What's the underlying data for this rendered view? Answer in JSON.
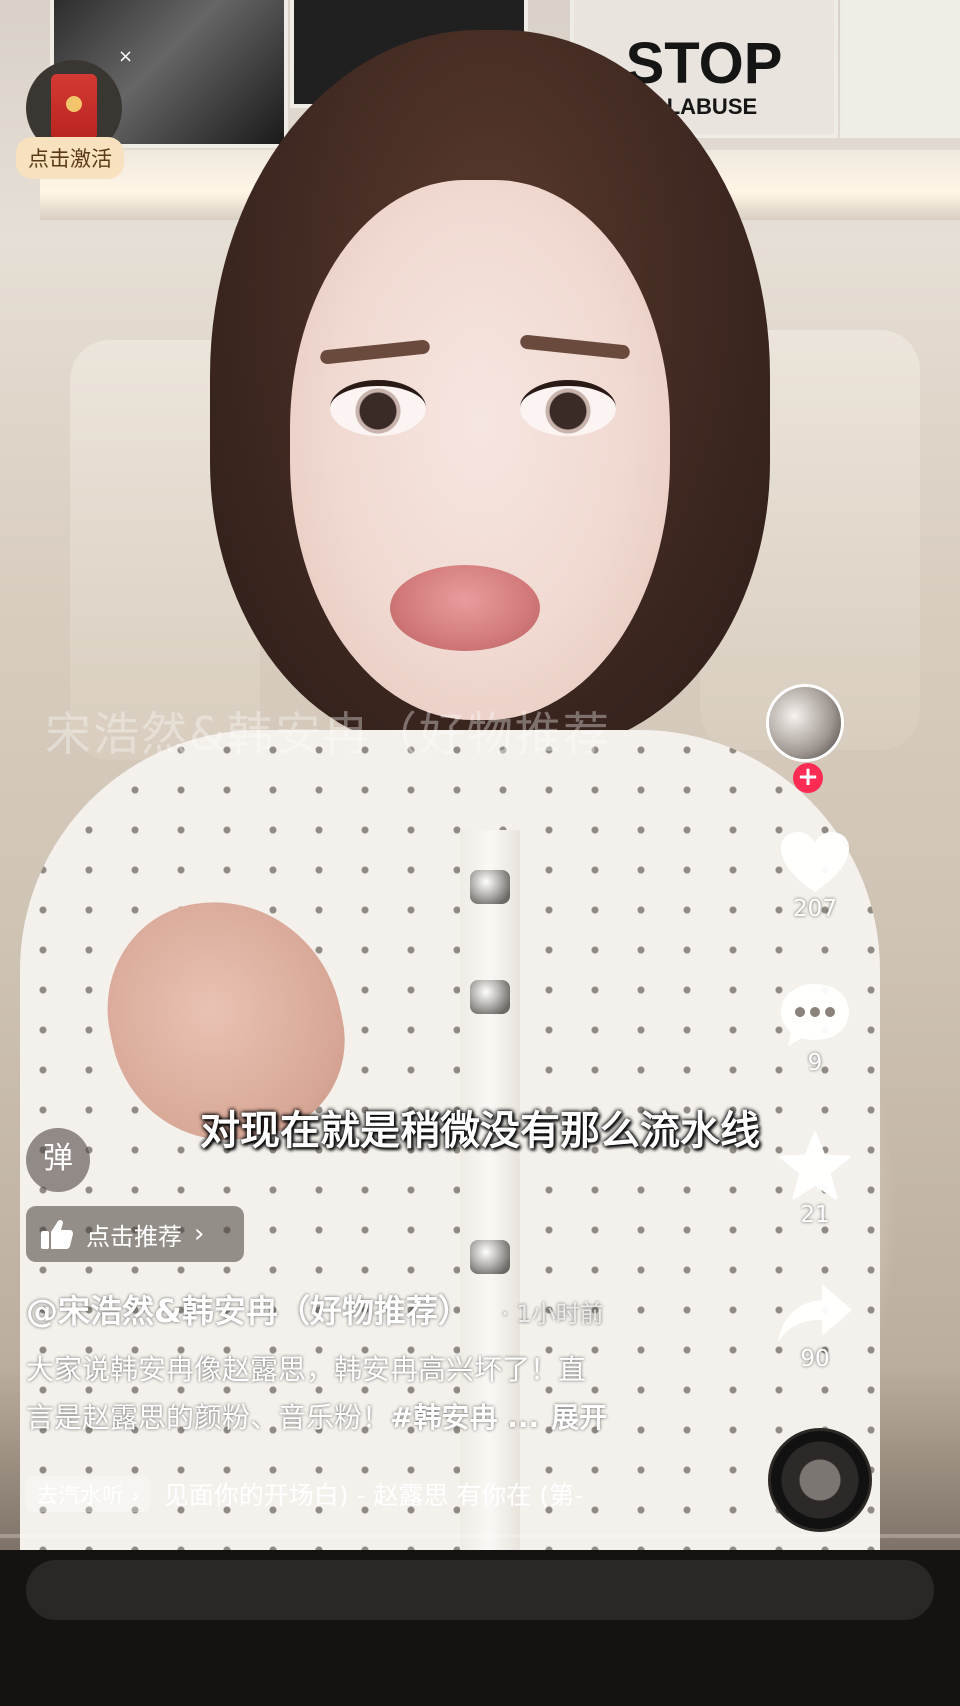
{
  "background_text": {
    "poster_stop": "STOP",
    "poster_abuse": "ALABUSE"
  },
  "red_packet": {
    "activate_label": "点击激活",
    "close_glyph": "×"
  },
  "video": {
    "watermark": "宋浩然&韩安冉（好物推荐",
    "subtitle": "对现在就是稍微没有那么流水线"
  },
  "right_rail": {
    "follow_glyph": "+",
    "likes": "207",
    "comments": "9",
    "favorites": "21",
    "shares": "90"
  },
  "overlay": {
    "danmaku_label": "弹",
    "recommend_label": "点击推荐",
    "recommend_chevron": "›"
  },
  "post": {
    "author": "@宋浩然&韩安冉（好物推荐）",
    "time_ago": "· 1小时前",
    "description_line1": "大家说韩安冉像赵露思，韩安冉高兴坏了！直",
    "description_line2": "言是赵露思的颜粉、音乐粉！",
    "hashtag": "#韩安冉 ...",
    "expand_label": "展开"
  },
  "music": {
    "listen_label": "去汽水听 ›",
    "song": "见面你的开场白) - 赵露思     有你在 (第-"
  },
  "colors": {
    "follow_red": "#fe2c55",
    "activate_chip": "#f7e1bf",
    "red_packet": "#d43a33"
  }
}
